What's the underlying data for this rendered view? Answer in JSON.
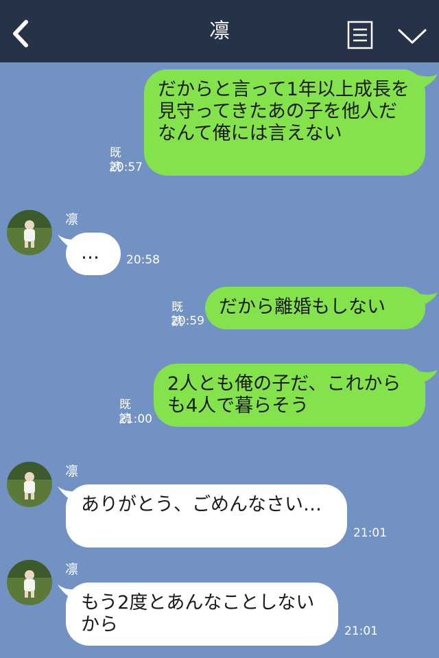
{
  "header": {
    "title": "凛",
    "icons": {
      "back": "chevron-left-icon",
      "menu": "list-icon",
      "more": "chevron-down-icon"
    }
  },
  "colors": {
    "background": "#7292c3",
    "header": "#263248",
    "sent_bubble": "#84e34d",
    "received_bubble": "#ffffff"
  },
  "messages": [
    {
      "direction": "sent",
      "text": "だからと言って1年以上成長を見守ってきたあの子を他人だなんて俺には言えない",
      "read": "既読",
      "time": "20:57"
    },
    {
      "direction": "received",
      "sender": "凛",
      "text": "…",
      "time": "20:58"
    },
    {
      "direction": "sent",
      "text": "だから離婚もしない",
      "read": "既読",
      "time": "20:59"
    },
    {
      "direction": "sent",
      "text": "2人とも俺の子だ、これからも4人で暮らそう",
      "read": "既読",
      "time": "21:00"
    },
    {
      "direction": "received",
      "sender": "凛",
      "text": "ありがとう、ごめんなさい…",
      "time": "21:01"
    },
    {
      "direction": "received",
      "sender": "凛",
      "text": "もう2度とあんなことしないから",
      "time": "21:01"
    }
  ]
}
